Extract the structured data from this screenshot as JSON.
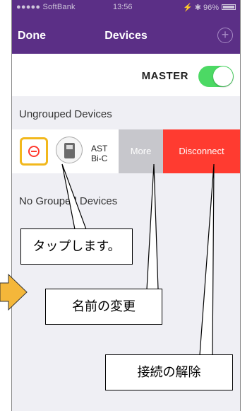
{
  "status_bar": {
    "carrier": "●●●●● SoftBank",
    "time": "13:56",
    "indicators": "⚡ ✱ 96%"
  },
  "nav": {
    "left_button": "Done",
    "title": "Devices",
    "right_icon": "plus-circle-icon"
  },
  "master": {
    "label": "MASTER",
    "enabled": true
  },
  "sections": {
    "ungrouped_header": "Ungrouped Devices",
    "grouped_header": "No Grouped Devices"
  },
  "device": {
    "name": "AST",
    "subtitle": "Bi-C",
    "more_label": "More",
    "disconnect_label": "Disconnect"
  },
  "callouts": {
    "tap": "タップします。",
    "rename": "名前の変更",
    "disconnect": "接続の解除"
  },
  "colors": {
    "nav_purple": "#5b2f86",
    "toggle_green": "#4cd964",
    "disconnect_red": "#ff3b30",
    "more_gray": "#c7c7cc",
    "highlight_orange": "#f2b81c"
  }
}
